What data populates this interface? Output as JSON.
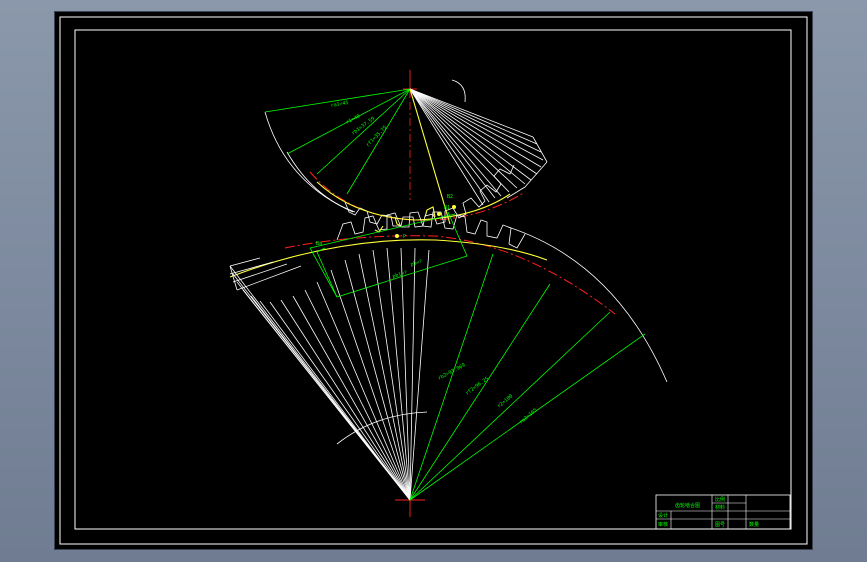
{
  "drawing": {
    "upper_gear": {
      "dim_labels": [
        "ra1=45",
        "r1=40",
        "rb1=37.59",
        "rf1=35.75"
      ]
    },
    "lower_gear": {
      "dim_labels": [
        "rb2=93.969",
        "rf2=96.25",
        "r2=100",
        "ra2=105"
      ]
    },
    "line_of_action": {
      "labels": [
        "B1",
        "B2",
        "P",
        "Ba",
        "pb=?",
        "pb1=?"
      ]
    },
    "title_block": {
      "title": "齿轮啮合图",
      "cells": [
        "设计",
        "审核",
        "比例",
        "材料",
        "图号",
        "数量"
      ]
    }
  },
  "colors": {
    "background": "#000000",
    "dimension": "#00ff00",
    "gear_outline": "#ffffff",
    "pitch_circle": "#ff2020",
    "working_profile": "#ffff3a"
  }
}
